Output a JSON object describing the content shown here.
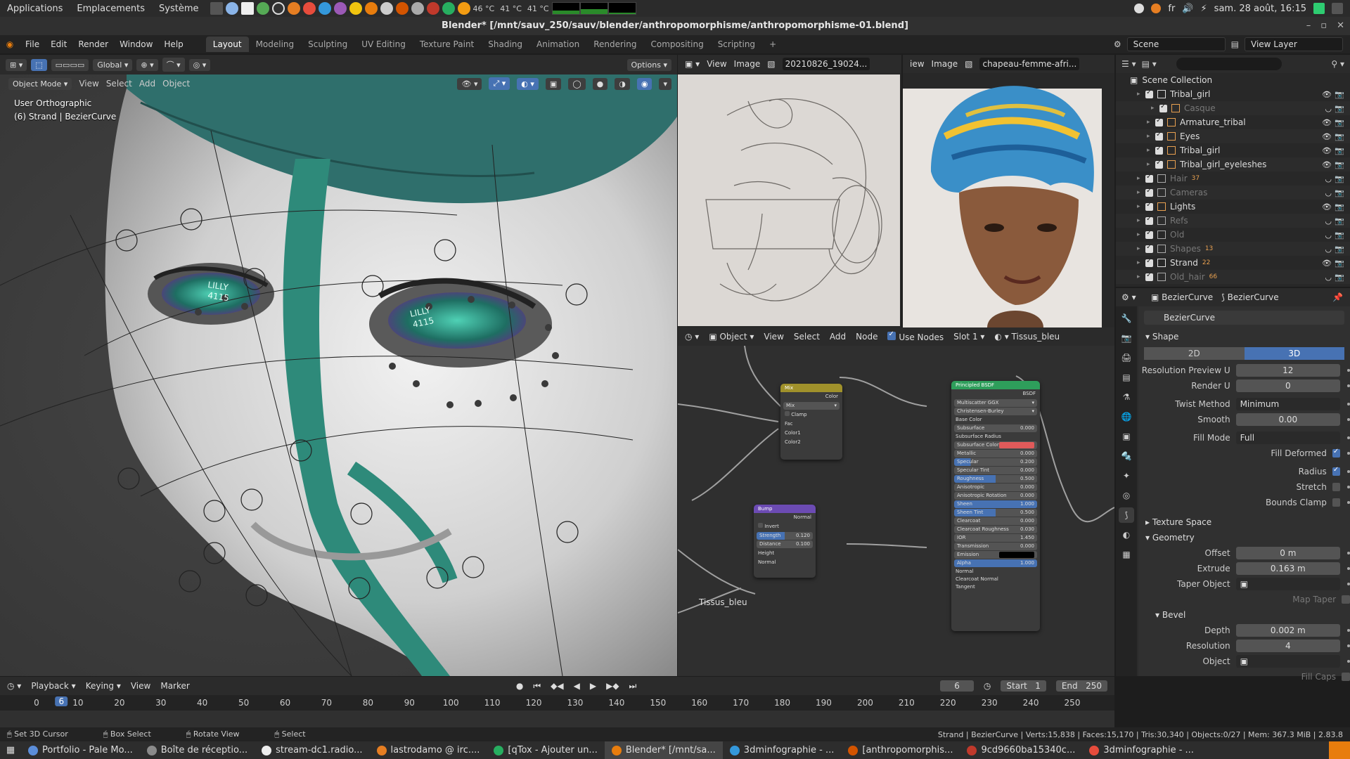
{
  "os_panel": {
    "menus": [
      "Applications",
      "Emplacements",
      "Système"
    ],
    "temps": [
      "46 °C",
      "41 °C",
      "41 °C"
    ],
    "lang": "fr",
    "datetime": "sam. 28 août, 16:15"
  },
  "window": {
    "title": "Blender* [/mnt/sauv_250/sauv/blender/anthropomorphisme/anthropomorphisme-01.blend]"
  },
  "topbar": {
    "menus": [
      "File",
      "Edit",
      "Render",
      "Window",
      "Help"
    ],
    "workspaces": [
      "Layout",
      "Modeling",
      "Sculpting",
      "UV Editing",
      "Texture Paint",
      "Shading",
      "Animation",
      "Rendering",
      "Compositing",
      "Scripting"
    ],
    "active_workspace": "Layout",
    "scene": "Scene",
    "view_layer": "View Layer"
  },
  "viewport": {
    "transform": "Global",
    "options": "Options",
    "mode": "Object Mode",
    "menus": [
      "View",
      "Select",
      "Add",
      "Object"
    ],
    "info_line1": "User Orthographic",
    "info_line2": "(6) Strand | BezierCurve"
  },
  "image_editor_1": {
    "menus": [
      "View",
      "Image"
    ],
    "image_name": "20210826_19024..."
  },
  "image_editor_2": {
    "menus": [
      "iew",
      "Image"
    ],
    "image_name": "chapeau-femme-afri..."
  },
  "node_editor": {
    "context": "Object",
    "menus": [
      "View",
      "Select",
      "Add",
      "Node"
    ],
    "use_nodes_label": "Use Nodes",
    "slot": "Slot 1",
    "material": "Tissus_bleu",
    "frame_label": "Tissus_bleu",
    "mix_node": {
      "title": "Mix",
      "out": "Color",
      "blend": "Mix",
      "clamp": "Clamp",
      "inputs": [
        "Fac",
        "Color1",
        "Color2"
      ]
    },
    "bump_node": {
      "title": "Bump",
      "out": "Normal",
      "invert": "Invert",
      "fields": [
        {
          "label": "Strength",
          "value": "0.120"
        },
        {
          "label": "Distance",
          "value": "0.100"
        }
      ],
      "inputs": [
        "Height",
        "Normal"
      ]
    },
    "bsdf_node": {
      "title": "Principled BSDF",
      "out": "BSDF",
      "dist": "Multiscatter GGX",
      "sss_method": "Christensen-Burley",
      "rows": [
        {
          "label": "Base Color",
          "value": ""
        },
        {
          "label": "Subsurface",
          "value": "0.000"
        },
        {
          "label": "Subsurface Radius",
          "value": ""
        },
        {
          "label": "Subsurface Color",
          "value": ""
        },
        {
          "label": "Metallic",
          "value": "0.000"
        },
        {
          "label": "Specular",
          "value": "0.200"
        },
        {
          "label": "Specular Tint",
          "value": "0.000"
        },
        {
          "label": "Roughness",
          "value": "0.500"
        },
        {
          "label": "Anisotropic",
          "value": "0.000"
        },
        {
          "label": "Anisotropic Rotation",
          "value": "0.000"
        },
        {
          "label": "Sheen",
          "value": "1.000"
        },
        {
          "label": "Sheen Tint",
          "value": "0.500"
        },
        {
          "label": "Clearcoat",
          "value": "0.000"
        },
        {
          "label": "Clearcoat Roughness",
          "value": "0.030"
        },
        {
          "label": "IOR",
          "value": "1.450"
        },
        {
          "label": "Transmission",
          "value": "0.000"
        },
        {
          "label": "Emission",
          "value": ""
        },
        {
          "label": "Alpha",
          "value": "1.000"
        },
        {
          "label": "Normal",
          "value": ""
        },
        {
          "label": "Clearcoat Normal",
          "value": ""
        },
        {
          "label": "Tangent",
          "value": ""
        }
      ]
    }
  },
  "outliner": {
    "root": "Scene Collection",
    "rows": [
      {
        "label": "Tribal_girl",
        "dim": false,
        "count": ""
      },
      {
        "label": "Casque",
        "dim": true,
        "count": ""
      },
      {
        "label": "Armature_tribal",
        "dim": false,
        "count": ""
      },
      {
        "label": "Eyes",
        "dim": false,
        "count": ""
      },
      {
        "label": "Tribal_girl",
        "dim": false,
        "count": ""
      },
      {
        "label": "Tribal_girl_eyeleshes",
        "dim": false,
        "count": ""
      },
      {
        "label": "Hair",
        "dim": true,
        "count": "37"
      },
      {
        "label": "Cameras",
        "dim": true,
        "count": ""
      },
      {
        "label": "Lights",
        "dim": false,
        "count": ""
      },
      {
        "label": "Refs",
        "dim": true,
        "count": ""
      },
      {
        "label": "Old",
        "dim": true,
        "count": ""
      },
      {
        "label": "Shapes",
        "dim": true,
        "count": "13"
      },
      {
        "label": "Strand",
        "dim": false,
        "count": "22"
      },
      {
        "label": "Old_hair",
        "dim": true,
        "count": "66"
      }
    ]
  },
  "properties": {
    "breadcrumb_1": "BezierCurve",
    "breadcrumb_2": "BezierCurve",
    "name": "BezierCurve",
    "shape": {
      "title": "Shape",
      "dim_2d": "2D",
      "dim_3d": "3D",
      "resolution_preview_u_label": "Resolution Preview U",
      "resolution_preview_u": "12",
      "render_u_label": "Render U",
      "render_u": "0",
      "twist_method_label": "Twist Method",
      "twist_method": "Minimum",
      "smooth_label": "Smooth",
      "smooth": "0.00",
      "fill_mode_label": "Fill Mode",
      "fill_mode": "Full",
      "fill_deformed": "Fill Deformed",
      "radius": "Radius",
      "stretch": "Stretch",
      "bounds_clamp": "Bounds Clamp"
    },
    "texture_space": "Texture Space",
    "geometry": {
      "title": "Geometry",
      "offset_label": "Offset",
      "offset": "0 m",
      "extrude_label": "Extrude",
      "extrude": "0.163 m",
      "taper_label": "Taper Object",
      "map_taper": "Map Taper"
    },
    "bevel": {
      "title": "Bevel",
      "depth_label": "Depth",
      "depth": "0.002 m",
      "resolution_label": "Resolution",
      "resolution": "4",
      "object_label": "Object",
      "fill_caps": "Fill Caps"
    }
  },
  "timeline": {
    "menus": [
      "Playback",
      "Keying",
      "View",
      "Marker"
    ],
    "current_frame": "6",
    "start_label": "Start",
    "start": "1",
    "end_label": "End",
    "end": "250",
    "ticks": [
      "0",
      "10",
      "20",
      "30",
      "40",
      "50",
      "60",
      "70",
      "80",
      "90",
      "100",
      "110",
      "120",
      "130",
      "140",
      "150",
      "160",
      "170",
      "180",
      "190",
      "200",
      "210",
      "220",
      "230",
      "240",
      "250"
    ]
  },
  "statusbar": {
    "hints": [
      "Set 3D Cursor",
      "Box Select",
      "Rotate View",
      "Select"
    ],
    "stats": "Strand | BezierCurve | Verts:15,838 | Faces:15,170 | Tris:30,340 | Objects:0/27 | Mem: 367.3 MiB | 2.83.8"
  },
  "taskbar": {
    "tasks": [
      {
        "label": "Portfolio - Pale Mo...",
        "active": false
      },
      {
        "label": "Boîte de réceptio...",
        "active": false
      },
      {
        "label": "stream-dc1.radio...",
        "active": false
      },
      {
        "label": "lastrodamo @ irc....",
        "active": false
      },
      {
        "label": "[qTox - Ajouter un...",
        "active": false
      },
      {
        "label": "Blender* [/mnt/sa...",
        "active": true
      },
      {
        "label": "3dminfographie - ...",
        "active": false
      },
      {
        "label": "[anthropomorphis...",
        "active": false
      },
      {
        "label": "9cd9660ba15340c...",
        "active": false
      },
      {
        "label": "3dminfographie - ...",
        "active": false
      }
    ]
  },
  "colors": {
    "accent": "#4772b3",
    "blender_orange": "#e87d0d",
    "teal_stripe": "#2e8a7a",
    "subsurface_color": "#e05a5a"
  }
}
